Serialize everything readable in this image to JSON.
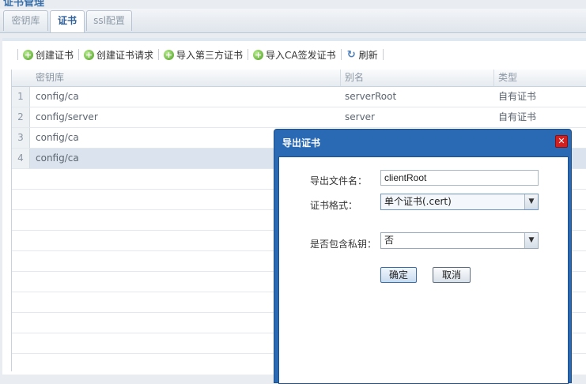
{
  "page": {
    "title": "证书管理"
  },
  "tabs": [
    {
      "label": "密钥库",
      "active": false
    },
    {
      "label": "证书",
      "active": true
    },
    {
      "label": "ssl配置",
      "active": false
    }
  ],
  "toolbar": {
    "create_cert": "创建证书",
    "create_request": "创建证书请求",
    "import_third_party": "导入第三方证书",
    "import_ca": "导入CA签发证书",
    "refresh": "刷新"
  },
  "grid": {
    "columns": [
      "密钥库",
      "别名",
      "类型"
    ],
    "rows": [
      {
        "n": "1",
        "keystore": "config/ca",
        "alias": "serverRoot",
        "type": "自有证书"
      },
      {
        "n": "2",
        "keystore": "config/server",
        "alias": "server",
        "type": "自有证书"
      },
      {
        "n": "3",
        "keystore": "config/ca",
        "alias": "",
        "type": ""
      },
      {
        "n": "4",
        "keystore": "config/ca",
        "alias": "",
        "type": ""
      }
    ]
  },
  "dialog": {
    "title": "导出证书",
    "file_name_label": "导出文件名：",
    "file_name_value": "clientRoot",
    "format_label": "证书格式：",
    "format_value": "单个证书(.cert)",
    "private_key_label": "是否包含私钥：",
    "private_key_value": "否",
    "ok": "确定",
    "cancel": "取消"
  },
  "colors": {
    "dialog_title_bg": "#2a6ab4",
    "selected_row": "#dbe4ee",
    "close_button": "#d21f1f"
  }
}
